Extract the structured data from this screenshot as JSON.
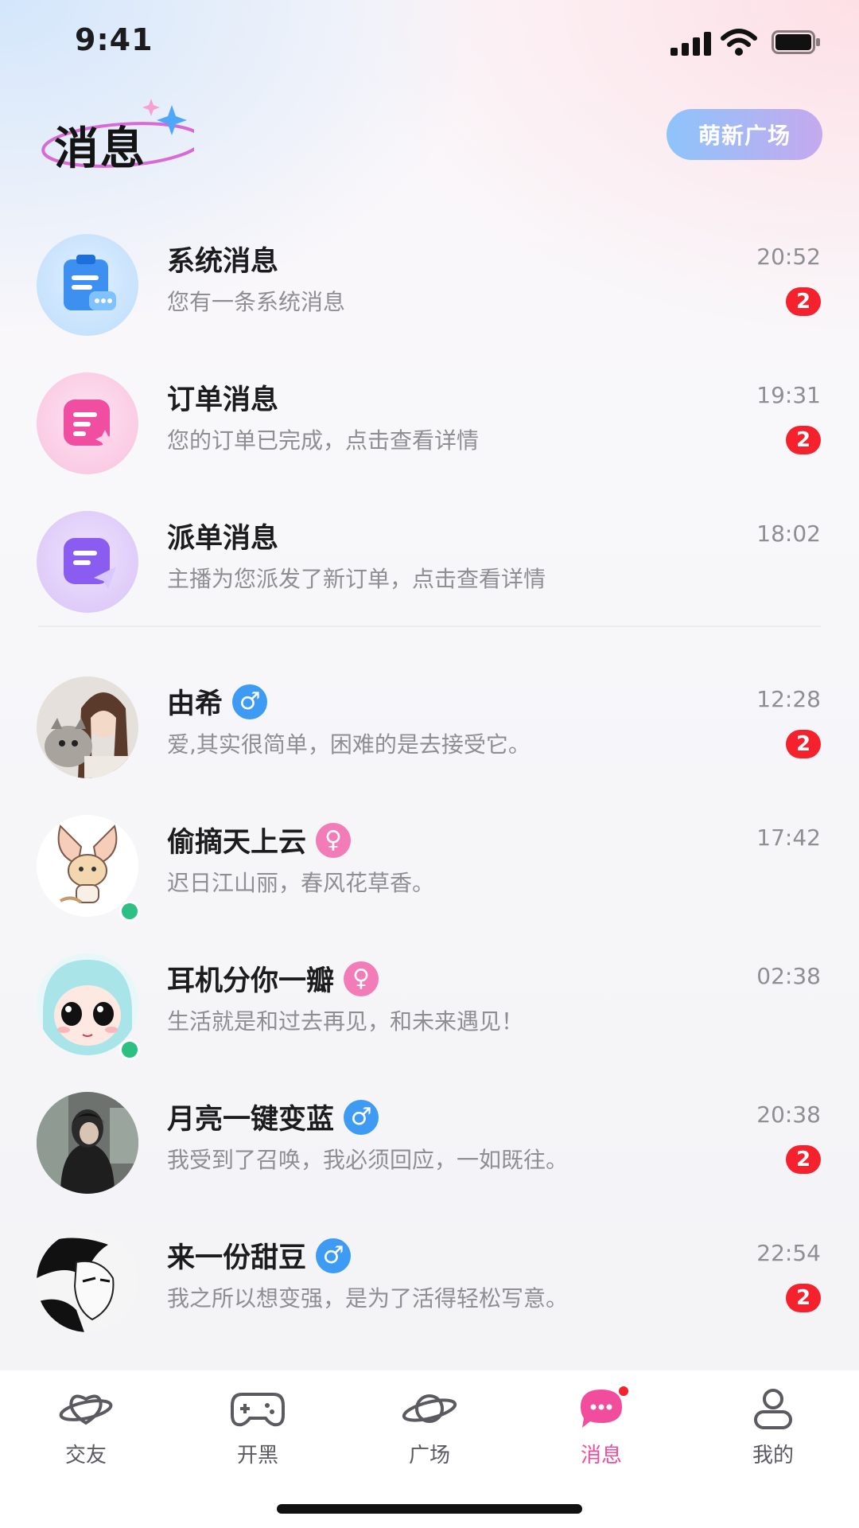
{
  "status_bar": {
    "time": "9:41"
  },
  "header": {
    "title": "消息",
    "plaza_button": "萌新广场"
  },
  "system_messages": [
    {
      "name": "系统消息",
      "preview": "您有一条系统消息",
      "time": "20:52",
      "badge": "2",
      "icon": "clipboard-chat-icon",
      "color": "#4aa3f5"
    },
    {
      "name": "订单消息",
      "preview": "您的订单已完成，点击查看详情",
      "time": "19:31",
      "badge": "2",
      "icon": "order-doc-icon",
      "color": "#f25aa8"
    },
    {
      "name": "派单消息",
      "preview": "主播为您派发了新订单，点击查看详情",
      "time": "18:02",
      "badge": "",
      "icon": "dispatch-send-icon",
      "color": "#8a5df0"
    }
  ],
  "chats": [
    {
      "name": "由希",
      "gender": "male",
      "gender_symbol": "♂",
      "preview": "爱,其实很简单，困难的是去接受它。",
      "time": "12:28",
      "badge": "2",
      "online": false
    },
    {
      "name": "偷摘天上云",
      "gender": "female",
      "gender_symbol": "♀",
      "preview": "迟日江山丽，春风花草香。",
      "time": "17:42",
      "badge": "",
      "online": true
    },
    {
      "name": "耳机分你一瓣",
      "gender": "female",
      "gender_symbol": "♀",
      "preview": "生活就是和过去再见，和未来遇见！",
      "time": "02:38",
      "badge": "",
      "online": true
    },
    {
      "name": "月亮一键变蓝",
      "gender": "male",
      "gender_symbol": "♂",
      "preview": "我受到了召唤，我必须回应，一如既往。",
      "time": "20:38",
      "badge": "2",
      "online": false
    },
    {
      "name": "来一份甜豆",
      "gender": "male",
      "gender_symbol": "♂",
      "preview": "我之所以想变强，是为了活得轻松写意。",
      "time": "22:54",
      "badge": "2",
      "online": false
    }
  ],
  "tabs": [
    {
      "label": "交友",
      "icon": "heart-planet-icon",
      "active": false
    },
    {
      "label": "开黑",
      "icon": "gamepad-icon",
      "active": false
    },
    {
      "label": "广场",
      "icon": "planet-icon",
      "active": false
    },
    {
      "label": "消息",
      "icon": "chat-bubble-icon",
      "active": true
    },
    {
      "label": "我的",
      "icon": "person-icon",
      "active": false
    }
  ],
  "colors": {
    "accent": "#f24c9c",
    "badge": "#f5222d",
    "male": "#3d9bf3",
    "female": "#f27bb8",
    "online": "#2dc083"
  }
}
